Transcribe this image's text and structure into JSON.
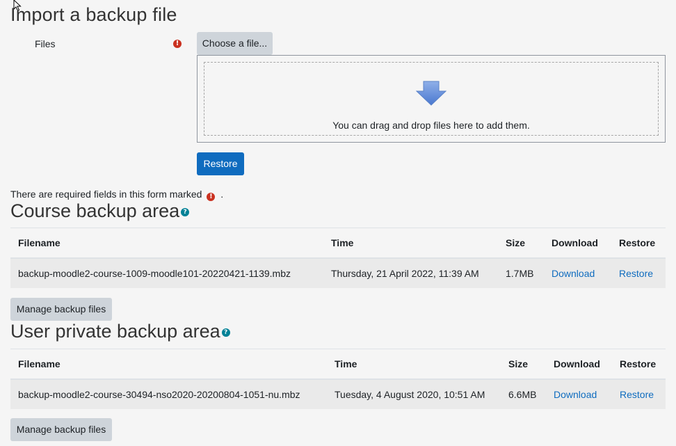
{
  "import": {
    "title": "Import a backup file",
    "files_label": "Files",
    "choose_file_label": "Choose a file...",
    "drop_hint": "You can drag and drop files here to add them.",
    "restore_label": "Restore",
    "required_note": "There are required fields in this form marked",
    "required_note_end": ".",
    "required_icon_glyph": "!"
  },
  "course_area": {
    "title": "Course backup area",
    "help_glyph": "?",
    "columns": [
      "Filename",
      "Time",
      "Size",
      "Download",
      "Restore"
    ],
    "rows": [
      {
        "filename": "backup-moodle2-course-1009-moodle101-20220421-1139.mbz",
        "time": "Thursday, 21 April 2022, 11:39 AM",
        "size": "1.7MB",
        "download": "Download",
        "restore": "Restore"
      }
    ],
    "manage_label": "Manage backup files"
  },
  "user_area": {
    "title": "User private backup area",
    "help_glyph": "?",
    "columns": [
      "Filename",
      "Time",
      "Size",
      "Download",
      "Restore"
    ],
    "rows": [
      {
        "filename": "backup-moodle2-course-30494-nso2020-20200804-1051-nu.mbz",
        "time": "Tuesday, 4 August 2020, 10:51 AM",
        "size": "6.6MB",
        "download": "Download",
        "restore": "Restore"
      }
    ],
    "manage_label": "Manage backup files"
  },
  "colors": {
    "primary": "#0f6cbf",
    "required": "#ca3120",
    "help": "#008196",
    "button_grey": "#ced4da"
  }
}
